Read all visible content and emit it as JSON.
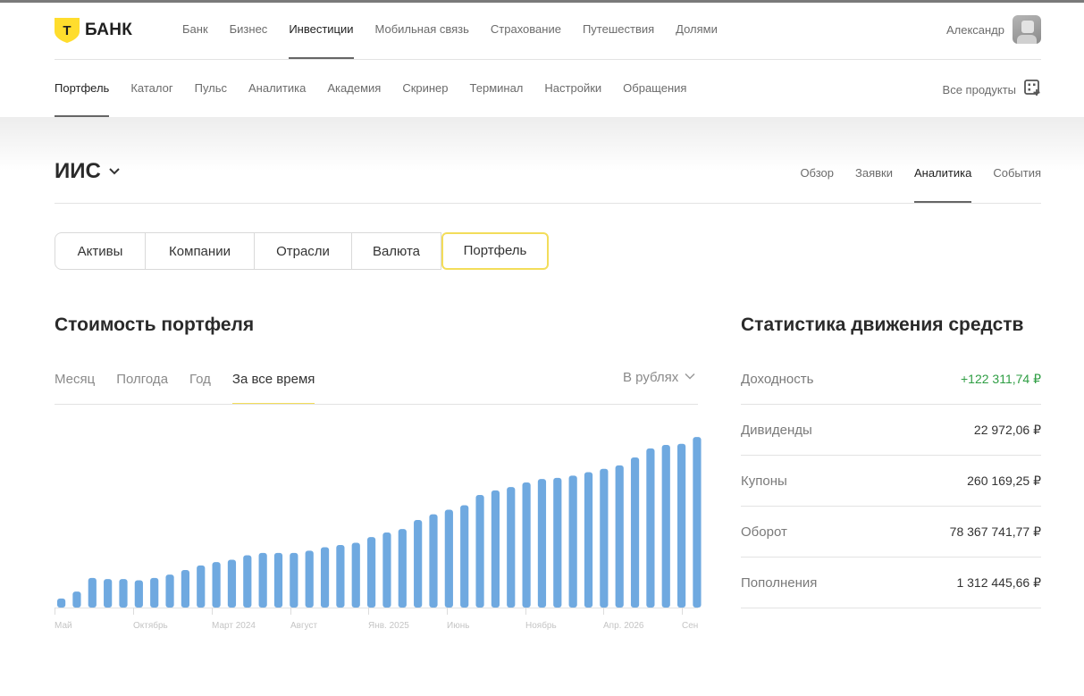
{
  "brand": {
    "logo_letter": "Т",
    "name": "БАНК"
  },
  "colors": {
    "accent_yellow": "#ffdd2d",
    "bar_blue": "#6fa9e0",
    "positive_green": "#2f9e44"
  },
  "top_nav": [
    "Банк",
    "Бизнес",
    "Инвестиции",
    "Мобильная связь",
    "Страхование",
    "Путешествия",
    "Долями"
  ],
  "top_nav_active": "Инвестиции",
  "user": {
    "name": "Александр",
    "avatar_icon": "avatar"
  },
  "sub_nav": [
    "Портфель",
    "Каталог",
    "Пульс",
    "Аналитика",
    "Академия",
    "Скринер",
    "Терминал",
    "Настройки",
    "Обращения"
  ],
  "sub_nav_active": "Портфель",
  "all_products": {
    "label": "Все продукты",
    "icon": "grid-plus-icon"
  },
  "account": {
    "title": "ИИС"
  },
  "account_tabs": [
    "Обзор",
    "Заявки",
    "Аналитика",
    "События"
  ],
  "account_tabs_active": "Аналитика",
  "segments": [
    "Активы",
    "Компании",
    "Отрасли",
    "Валюта",
    "Портфель"
  ],
  "segments_active": "Портфель",
  "portfolio": {
    "title": "Стоимость портфеля",
    "periods": [
      "Месяц",
      "Полгода",
      "Год",
      "За все время"
    ],
    "period_active": "За все время",
    "currency": "В рублях"
  },
  "chart_data": {
    "type": "bar",
    "x_tick_labels": [
      "Май",
      "Октябрь",
      "Март 2024",
      "Август",
      "Янв. 2025",
      "Июнь",
      "Ноябрь",
      "Апр. 2026",
      "Сен"
    ],
    "values": [
      8,
      14,
      26,
      25,
      25,
      24,
      26,
      29,
      33,
      37,
      40,
      42,
      46,
      48,
      48,
      48,
      50,
      53,
      55,
      57,
      62,
      66,
      69,
      77,
      82,
      86,
      90,
      99,
      103,
      106,
      110,
      113,
      114,
      116,
      119,
      122,
      125,
      132,
      140,
      143,
      144,
      150,
      160,
      150
    ],
    "ylim": [
      0,
      165
    ],
    "grid": false,
    "legend": "none"
  },
  "stats": {
    "title": "Статистика движения средств",
    "rows": [
      {
        "label": "Доходность",
        "value": "+122 311,74 ₽",
        "positive": true
      },
      {
        "label": "Дивиденды",
        "value": "22 972,06 ₽",
        "positive": false
      },
      {
        "label": "Купоны",
        "value": "260 169,25 ₽",
        "positive": false
      },
      {
        "label": "Оборот",
        "value": "78 367 741,77 ₽",
        "positive": false
      },
      {
        "label": "Пополнения",
        "value": "1 312 445,66 ₽",
        "positive": false
      }
    ]
  }
}
